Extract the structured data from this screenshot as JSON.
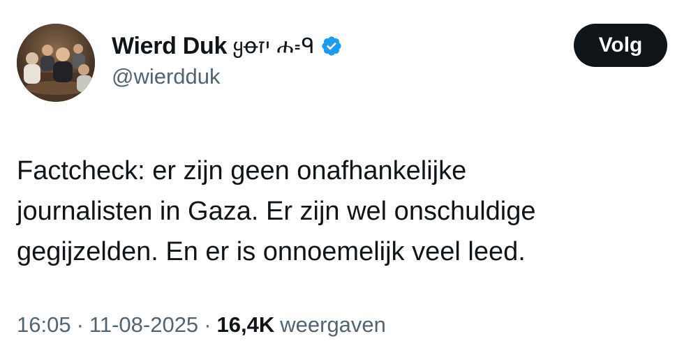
{
  "author": {
    "display_name": "Wierd Duk",
    "name_extra": "ყꝋיז ሐ꞊ᑫ",
    "handle": "@wierdduk",
    "verified": true,
    "verified_color": "#1d9bf0"
  },
  "follow_button": {
    "label": "Volg"
  },
  "tweet": {
    "lines": [
      "Factcheck: er zijn geen onafhankelijke",
      "journalisten in Gaza. Er zijn wel onschuldige",
      "gegijzelden. En er is onnoemelijk veel leed."
    ]
  },
  "meta": {
    "time": "16:05",
    "separator": "·",
    "date": "11-08-2025",
    "views_count": "16,4K",
    "views_label": "weergaven"
  },
  "colors": {
    "text": "#0f1419",
    "secondary": "#536471",
    "button_bg": "#0f1419"
  }
}
